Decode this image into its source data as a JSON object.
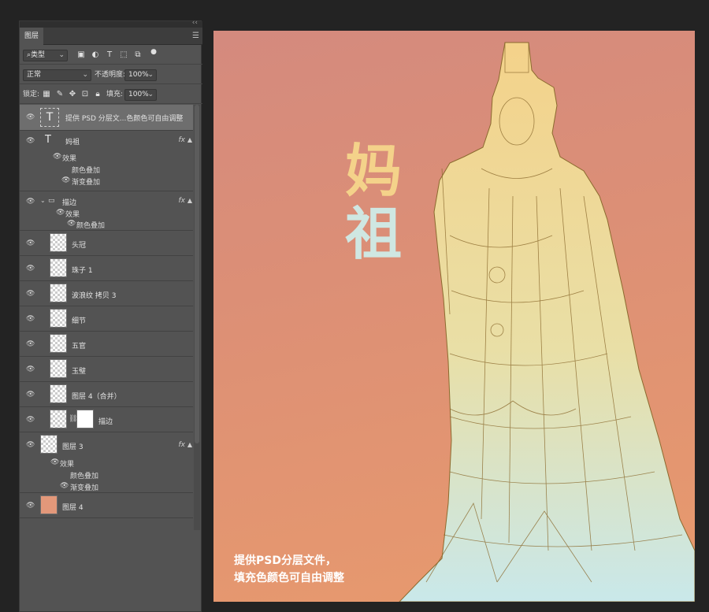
{
  "panel": {
    "tab_label": "图层",
    "filter": {
      "kind": "类型"
    },
    "blend": {
      "mode": "正常",
      "opacity_label": "不透明度:",
      "opacity": "100%"
    },
    "lock": {
      "label": "锁定:",
      "fill_label": "填充:",
      "fill": "100%"
    },
    "layers": [
      {
        "name": "提供 PSD 分层文...色颜色可自由调整",
        "kind": "text",
        "selected": true
      },
      {
        "name": "妈祖",
        "kind": "text",
        "fx": "fx",
        "effects_label": "效果",
        "effects": [
          "颜色叠加",
          "渐变叠加"
        ]
      },
      {
        "name": "描边",
        "kind": "group",
        "fx": "fx",
        "effects_label": "效果",
        "effects": [
          "颜色叠加"
        ]
      },
      {
        "name": "头冠"
      },
      {
        "name": "珠子 1"
      },
      {
        "name": "波浪纹 拷贝 3"
      },
      {
        "name": "细节"
      },
      {
        "name": "五官"
      },
      {
        "name": "玉璧"
      },
      {
        "name": "图层 4（合并）"
      },
      {
        "name": "描边",
        "mask": true
      },
      {
        "name": "图层 3",
        "fx": "fx",
        "effects_label": "效果",
        "effects": [
          "颜色叠加",
          "渐变叠加"
        ]
      },
      {
        "name": "图层 4",
        "thumb_color": "#e3987a"
      }
    ]
  },
  "canvas": {
    "title_line1": "妈",
    "title_line2": "祖",
    "caption_line1": "提供PSD分层文件，",
    "caption_line2": "填充色颜色可自由调整",
    "colors": {
      "bg_top": "#d48a7e",
      "bg_bottom": "#e89a6d",
      "statue_top": "#f4d28a",
      "statue_bottom": "#c9e8ea",
      "outline": "#8b6a2e"
    }
  }
}
